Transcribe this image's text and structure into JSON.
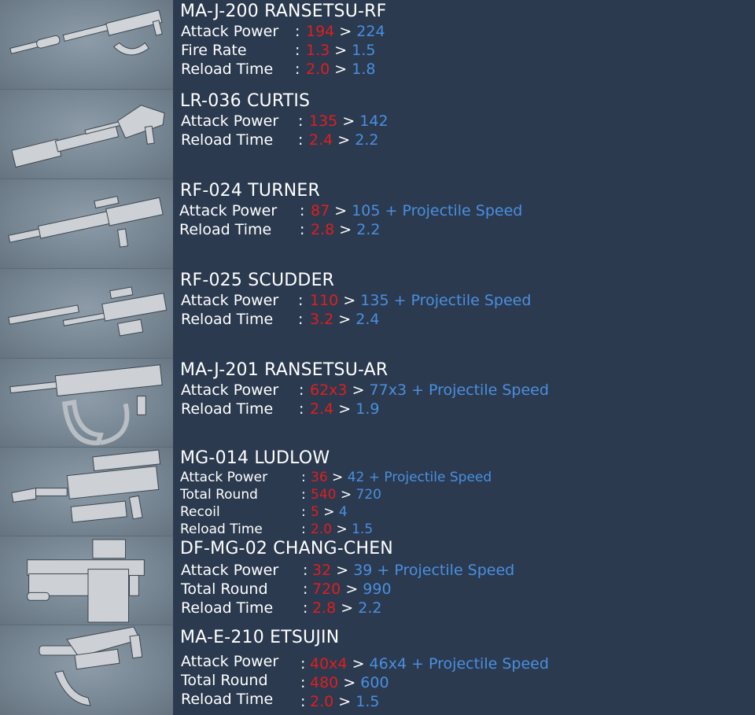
{
  "colors": {
    "background": "#2b3a4f",
    "old_value": "#e01e1e",
    "new_value": "#4a8fe0",
    "text": "#ffffff"
  },
  "separator": ":",
  "arrow": ">",
  "weapons": [
    {
      "name": "MA-J-200 RANSETSU-RF",
      "image_icon": "rifle-image",
      "stats": [
        {
          "label": "Attack Power",
          "old": "194",
          "new": "224"
        },
        {
          "label": "Fire Rate",
          "old": "1.3",
          "new": "1.5"
        },
        {
          "label": "Reload Time",
          "old": "2.0",
          "new": "1.8"
        }
      ]
    },
    {
      "name": "LR-036 CURTIS",
      "image_icon": "sniper-rifle-image",
      "stats": [
        {
          "label": "Attack Power",
          "old": "135",
          "new": "142"
        },
        {
          "label": "Reload Time",
          "old": "2.4",
          "new": "2.2"
        }
      ]
    },
    {
      "name": "RF-024 TURNER",
      "image_icon": "rifle-image",
      "stats": [
        {
          "label": "Attack Power",
          "old": "87",
          "new": "105 + Projectile Speed"
        },
        {
          "label": "Reload Time",
          "old": "2.8",
          "new": "2.2"
        }
      ]
    },
    {
      "name": "RF-025 SCUDDER",
      "image_icon": "rifle-image",
      "stats": [
        {
          "label": "Attack Power",
          "old": "110",
          "new": "135 + Projectile Speed"
        },
        {
          "label": "Reload Time",
          "old": "3.2",
          "new": "2.4"
        }
      ]
    },
    {
      "name": "MA-J-201 RANSETSU-AR",
      "image_icon": "assault-rifle-image",
      "stats": [
        {
          "label": "Attack Power",
          "old": "62x3",
          "new": "77x3 + Projectile Speed"
        },
        {
          "label": "Reload Time",
          "old": "2.4",
          "new": "1.9"
        }
      ]
    },
    {
      "name": "MG-014 LUDLOW",
      "image_icon": "machine-gun-image",
      "stats": [
        {
          "label": "Attack Power",
          "old": "36",
          "new": "42 + Projectile Speed"
        },
        {
          "label": "Total Round",
          "old": "540",
          "new": "720"
        },
        {
          "label": "Recoil",
          "old": "5",
          "new": "4"
        },
        {
          "label": "Reload Time",
          "old": "2.0",
          "new": "1.5"
        }
      ]
    },
    {
      "name": "DF-MG-02 CHANG-CHEN",
      "image_icon": "gatling-gun-image",
      "stats": [
        {
          "label": "Attack Power",
          "old": "32",
          "new": "39 + Projectile Speed"
        },
        {
          "label": "Total Round",
          "old": "720",
          "new": "990"
        },
        {
          "label": "Reload Time",
          "old": "2.8",
          "new": "2.2"
        }
      ]
    },
    {
      "name": "MA-E-210 ETSUJIN",
      "image_icon": "smg-image",
      "stats": [
        {
          "label": "Attack Power",
          "old": "40x4",
          "new": "46x4 + Projectile Speed"
        },
        {
          "label": "Total Round",
          "old": "480",
          "new": "600"
        },
        {
          "label": "Reload Time",
          "old": "2.0",
          "new": "1.5"
        }
      ]
    }
  ]
}
